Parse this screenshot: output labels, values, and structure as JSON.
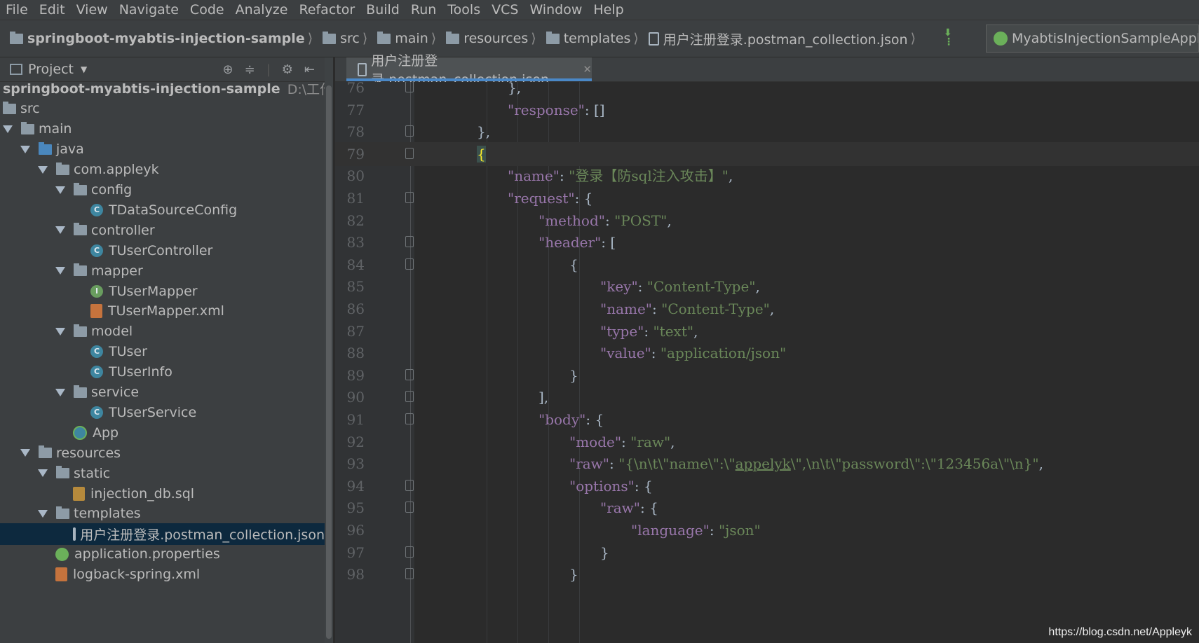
{
  "menu": [
    "File",
    "Edit",
    "View",
    "Navigate",
    "Code",
    "Analyze",
    "Refactor",
    "Build",
    "Run",
    "Tools",
    "VCS",
    "Window",
    "Help"
  ],
  "breadcrumbs": [
    {
      "label": "springboot-myabtis-injection-sample",
      "icon": "module-folder-icon"
    },
    {
      "label": "src",
      "icon": "folder-icon"
    },
    {
      "label": "main",
      "icon": "folder-icon"
    },
    {
      "label": "resources",
      "icon": "resources-folder-icon"
    },
    {
      "label": "templates",
      "icon": "folder-icon"
    },
    {
      "label": "用户注册登录.postman_collection.json",
      "icon": "json-file-icon"
    }
  ],
  "run_config": {
    "label": "MyabtisInjectionSampleApplicatio",
    "icon": "spring-boot-icon"
  },
  "project_panel": {
    "title": "Project"
  },
  "tree": [
    {
      "label": "springboot-myabtis-injection-sample",
      "hint": "D:\\工作\\github\\",
      "depth": 0,
      "icon": "none",
      "arrow": false,
      "bold": true
    },
    {
      "label": "src",
      "depth": 0,
      "icon": "folder",
      "arrow": false
    },
    {
      "label": "main",
      "depth": 0,
      "icon": "folder",
      "arrow": true
    },
    {
      "label": "java",
      "depth": 1,
      "icon": "folder-blue",
      "arrow": true
    },
    {
      "label": "com.appleyk",
      "depth": 2,
      "icon": "folder",
      "arrow": true
    },
    {
      "label": "config",
      "depth": 3,
      "icon": "folder",
      "arrow": true
    },
    {
      "label": "TDataSourceConfig",
      "depth": 4,
      "icon": "class",
      "arrow": false
    },
    {
      "label": "controller",
      "depth": 3,
      "icon": "folder",
      "arrow": true
    },
    {
      "label": "TUserController",
      "depth": 4,
      "icon": "class",
      "arrow": false
    },
    {
      "label": "mapper",
      "depth": 3,
      "icon": "folder",
      "arrow": true
    },
    {
      "label": "TUserMapper",
      "depth": 4,
      "icon": "interface",
      "arrow": false
    },
    {
      "label": "TUserMapper.xml",
      "depth": 4,
      "icon": "xml",
      "arrow": false
    },
    {
      "label": "model",
      "depth": 3,
      "icon": "folder",
      "arrow": true
    },
    {
      "label": "TUser",
      "depth": 4,
      "icon": "class",
      "arrow": false
    },
    {
      "label": "TUserInfo",
      "depth": 4,
      "icon": "class",
      "arrow": false
    },
    {
      "label": "service",
      "depth": 3,
      "icon": "folder",
      "arrow": true
    },
    {
      "label": "TUserService",
      "depth": 4,
      "icon": "class",
      "arrow": false
    },
    {
      "label": "App",
      "depth": 3,
      "icon": "app",
      "arrow": false
    },
    {
      "label": "resources",
      "depth": 1,
      "icon": "folder",
      "arrow": true
    },
    {
      "label": "static",
      "depth": 2,
      "icon": "folder",
      "arrow": true
    },
    {
      "label": "injection_db.sql",
      "depth": 3,
      "icon": "sql",
      "arrow": false
    },
    {
      "label": "templates",
      "depth": 2,
      "icon": "folder",
      "arrow": true
    },
    {
      "label": "用户注册登录.postman_collection.json",
      "depth": 3,
      "icon": "json",
      "arrow": false,
      "selected": true
    },
    {
      "label": "application.properties",
      "depth": 2,
      "icon": "properties",
      "arrow": false
    },
    {
      "label": "logback-spring.xml",
      "depth": 2,
      "icon": "xml",
      "arrow": false
    }
  ],
  "tab": {
    "label": "用户注册登录.postman_collection.json"
  },
  "code_lines": [
    {
      "n": "76",
      "indent": 2,
      "tokens": [
        [
          "p",
          "},"
        ]
      ]
    },
    {
      "n": "77",
      "indent": 2,
      "tokens": [
        [
          "k",
          "\"response\""
        ],
        [
          "p",
          ": []"
        ]
      ]
    },
    {
      "n": "78",
      "indent": 1,
      "tokens": [
        [
          "p",
          "},"
        ]
      ]
    },
    {
      "n": "79",
      "indent": 1,
      "tokens": [
        [
          "b",
          "{"
        ]
      ],
      "current": true
    },
    {
      "n": "80",
      "indent": 2,
      "tokens": [
        [
          "k",
          "\"name\""
        ],
        [
          "p",
          ": "
        ],
        [
          "s",
          "\"登录【防sql注入攻击】\""
        ],
        [
          "p",
          ","
        ]
      ]
    },
    {
      "n": "81",
      "indent": 2,
      "tokens": [
        [
          "k",
          "\"request\""
        ],
        [
          "p",
          ": {"
        ]
      ]
    },
    {
      "n": "82",
      "indent": 3,
      "tokens": [
        [
          "k",
          "\"method\""
        ],
        [
          "p",
          ": "
        ],
        [
          "s",
          "\"POST\""
        ],
        [
          "p",
          ","
        ]
      ]
    },
    {
      "n": "83",
      "indent": 3,
      "tokens": [
        [
          "k",
          "\"header\""
        ],
        [
          "p",
          ": ["
        ]
      ]
    },
    {
      "n": "84",
      "indent": 4,
      "tokens": [
        [
          "p",
          "{"
        ]
      ]
    },
    {
      "n": "85",
      "indent": 5,
      "tokens": [
        [
          "k",
          "\"key\""
        ],
        [
          "p",
          ": "
        ],
        [
          "s",
          "\"Content-Type\""
        ],
        [
          "p",
          ","
        ]
      ]
    },
    {
      "n": "86",
      "indent": 5,
      "tokens": [
        [
          "k",
          "\"name\""
        ],
        [
          "p",
          ": "
        ],
        [
          "s",
          "\"Content-Type\""
        ],
        [
          "p",
          ","
        ]
      ]
    },
    {
      "n": "87",
      "indent": 5,
      "tokens": [
        [
          "k",
          "\"type\""
        ],
        [
          "p",
          ": "
        ],
        [
          "s",
          "\"text\""
        ],
        [
          "p",
          ","
        ]
      ]
    },
    {
      "n": "88",
      "indent": 5,
      "tokens": [
        [
          "k",
          "\"value\""
        ],
        [
          "p",
          ": "
        ],
        [
          "s",
          "\"application/json\""
        ]
      ]
    },
    {
      "n": "89",
      "indent": 4,
      "tokens": [
        [
          "p",
          "}"
        ]
      ]
    },
    {
      "n": "90",
      "indent": 3,
      "tokens": [
        [
          "p",
          "],"
        ]
      ]
    },
    {
      "n": "91",
      "indent": 3,
      "tokens": [
        [
          "k",
          "\"body\""
        ],
        [
          "p",
          ": {"
        ]
      ]
    },
    {
      "n": "92",
      "indent": 4,
      "tokens": [
        [
          "k",
          "\"mode\""
        ],
        [
          "p",
          ": "
        ],
        [
          "s",
          "\"raw\""
        ],
        [
          "p",
          ","
        ]
      ]
    },
    {
      "n": "93",
      "indent": 4,
      "tokens": [
        [
          "k",
          "\"raw\""
        ],
        [
          "p",
          ": "
        ],
        [
          "s",
          "\"{\\n\\t\\\"name\\\":\\\""
        ],
        [
          "u",
          "appelyk"
        ],
        [
          "s",
          "\\\",\\n\\t\\\"password\\\":\\\"123456a\\\"\\n}\""
        ],
        [
          "p",
          ","
        ]
      ]
    },
    {
      "n": "94",
      "indent": 4,
      "tokens": [
        [
          "k",
          "\"options\""
        ],
        [
          "p",
          ": {"
        ]
      ]
    },
    {
      "n": "95",
      "indent": 5,
      "tokens": [
        [
          "k",
          "\"raw\""
        ],
        [
          "p",
          ": {"
        ]
      ]
    },
    {
      "n": "96",
      "indent": 6,
      "tokens": [
        [
          "k",
          "\"language\""
        ],
        [
          "p",
          ": "
        ],
        [
          "s",
          "\"json\""
        ]
      ]
    },
    {
      "n": "97",
      "indent": 5,
      "tokens": [
        [
          "p",
          "}"
        ]
      ]
    },
    {
      "n": "98",
      "indent": 4,
      "tokens": [
        [
          "p",
          "}"
        ]
      ]
    }
  ],
  "watermark": "https://blog.csdn.net/Appleyk"
}
